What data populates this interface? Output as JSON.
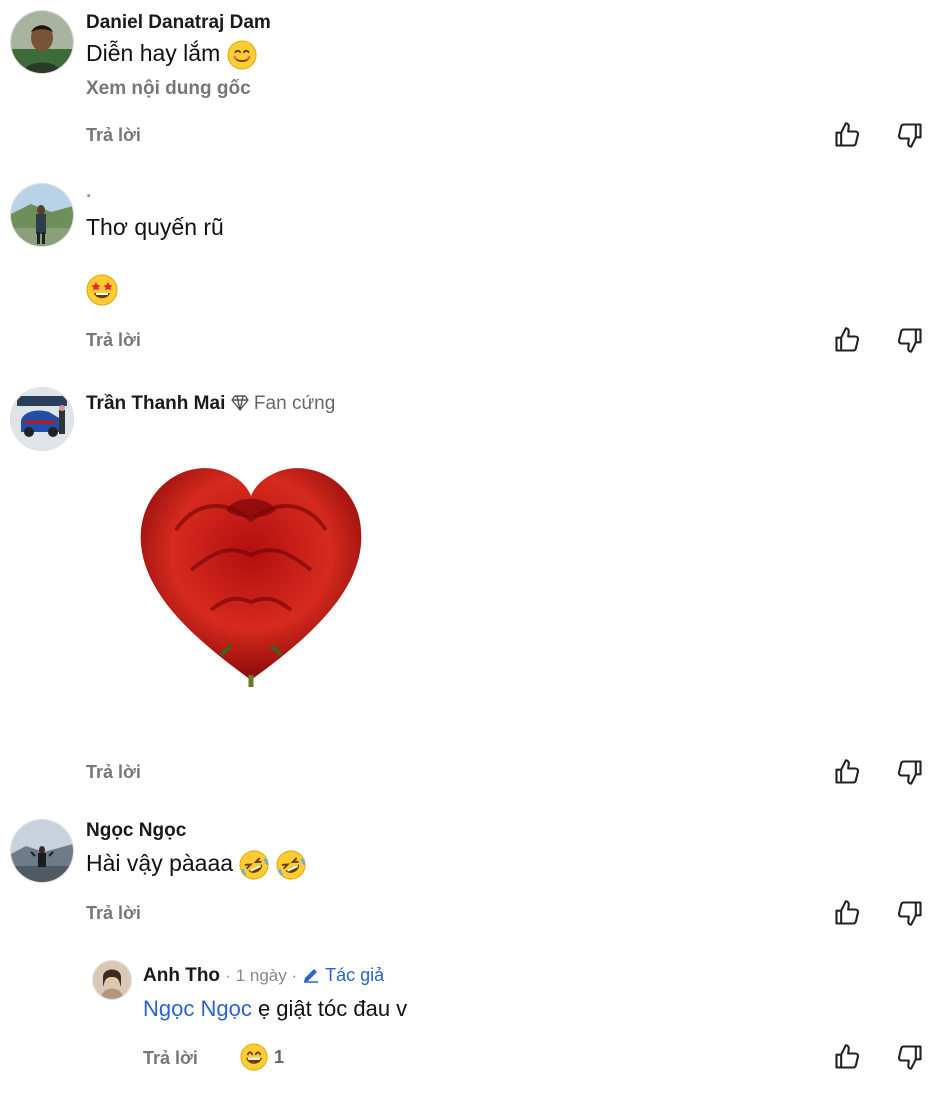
{
  "comments": [
    {
      "name": "Daniel Danatraj Dam",
      "text": "Diễn hay lắm",
      "translate_label": "Xem nội dung gốc",
      "reply_label": "Trả lời"
    },
    {
      "name": "·",
      "text": "Thơ quyến rũ",
      "reply_label": "Trả lời"
    },
    {
      "name": "Trần Thanh Mai",
      "badge": "Fan cứng",
      "reply_label": "Trả lời"
    },
    {
      "name": "Ngọc Ngọc",
      "text": "Hài vậy pàaaa",
      "reply_label": "Trả lời"
    }
  ],
  "reply": {
    "name": "Anh Tho",
    "time": "· 1 ngày ·",
    "author_tag": "Tác giả",
    "mention": "Ngọc Ngọc",
    "text": " ẹ giật tóc đau v",
    "reply_label": "Trả lời",
    "reaction_count": "1"
  },
  "icons": [
    "thumbs-up-icon",
    "thumbs-down-icon",
    "diamond-icon",
    "pencil-icon"
  ],
  "colors": {
    "link": "#2a62d8",
    "muted": "#777777"
  }
}
